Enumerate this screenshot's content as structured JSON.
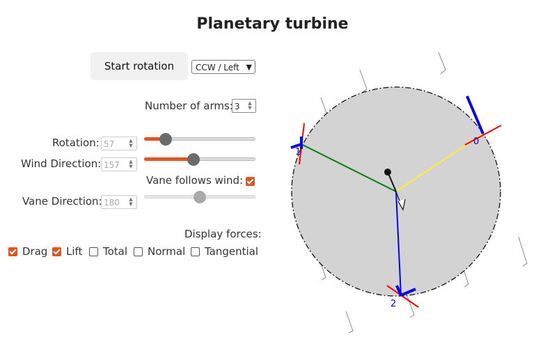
{
  "title": "Planetary turbine",
  "controls": {
    "start_button": "Start rotation",
    "direction_select": "CCW / Left",
    "arms_label": "Number of arms:",
    "arms_value": "3",
    "rotation_label": "Rotation:",
    "rotation_value": "57",
    "wind_label": "Wind Direction:",
    "wind_value": "157",
    "vane_follows_label": "Vane follows wind:",
    "vane_follows_checked": true,
    "vane_label": "Vane Direction:",
    "vane_value": "180"
  },
  "forces": {
    "label": "Display forces:",
    "items": [
      {
        "label": "Drag",
        "checked": true
      },
      {
        "label": "Lift",
        "checked": true
      },
      {
        "label": "Total",
        "checked": false
      },
      {
        "label": "Normal",
        "checked": false
      },
      {
        "label": "Tangential",
        "checked": false
      }
    ]
  },
  "diagram": {
    "arm_labels": [
      "0",
      "1",
      "2"
    ],
    "colors": {
      "accent": "#e8531c",
      "disk": "#d3d3d3",
      "arm0": "#ffee33",
      "arm1": "#008000",
      "arm2": "#0000ff",
      "drag": "#0000ff",
      "lift": "#ff0000"
    }
  }
}
